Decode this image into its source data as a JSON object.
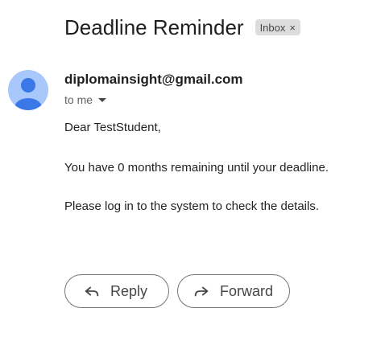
{
  "message": {
    "subject": "Deadline Reminder",
    "label": "Inbox",
    "label_remove": "×",
    "sender": "diplomainsight@gmail.com",
    "recipient_text": "to me",
    "body": {
      "greeting": "Dear TestStudent,",
      "line1": "You have 0 months remaining until your deadline.",
      "line2": "Please log in to the system to check the details."
    }
  },
  "actions": {
    "reply_label": "Reply",
    "forward_label": "Forward"
  },
  "colors": {
    "avatar_bg": "#a8c7fa",
    "avatar_fg": "#3b78e7",
    "chip_bg": "#dddddd"
  },
  "icons": {
    "avatar": "person-icon",
    "recipient_toggle": "caret-down-icon",
    "reply": "reply-arrow-icon",
    "forward": "forward-arrow-icon"
  }
}
